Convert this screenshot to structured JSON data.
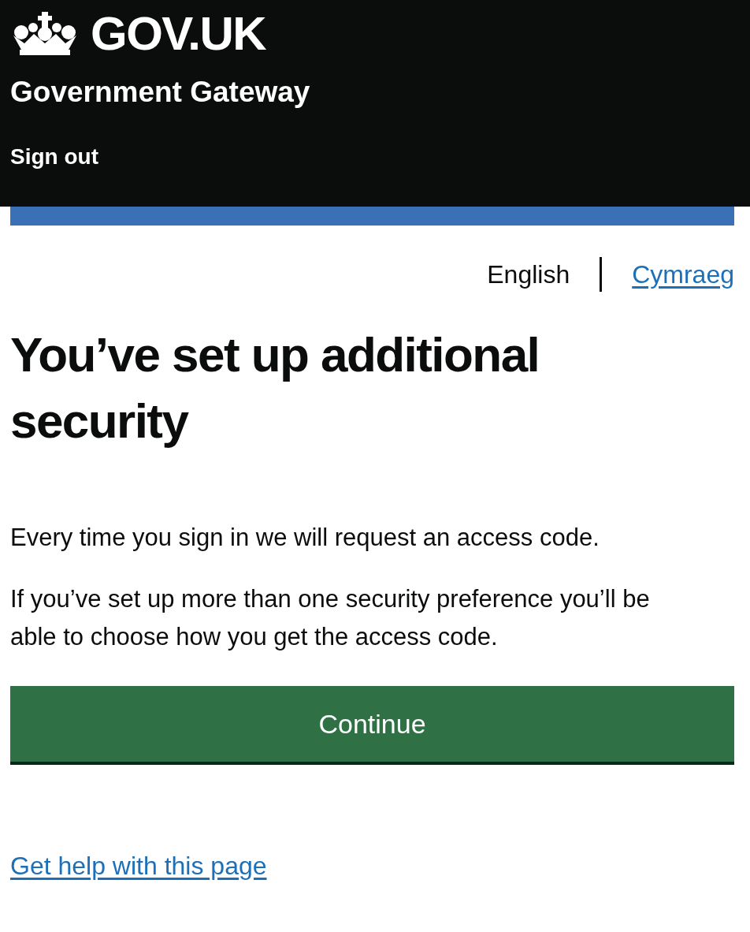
{
  "header": {
    "logo": "GOV.UK",
    "service": "Government Gateway",
    "sign_out": "Sign out"
  },
  "languages": [
    {
      "label": "English",
      "selected": true
    },
    {
      "label": "Cymraeg",
      "selected": false
    }
  ],
  "heading": "You’ve set up additional security",
  "paragraphs": [
    "Every time you sign in we will request an access code.",
    "If you’ve set up more than one security preference you’ll be able to choose how you get the access code."
  ],
  "button": "Continue",
  "help_link": "Get help with this page"
}
